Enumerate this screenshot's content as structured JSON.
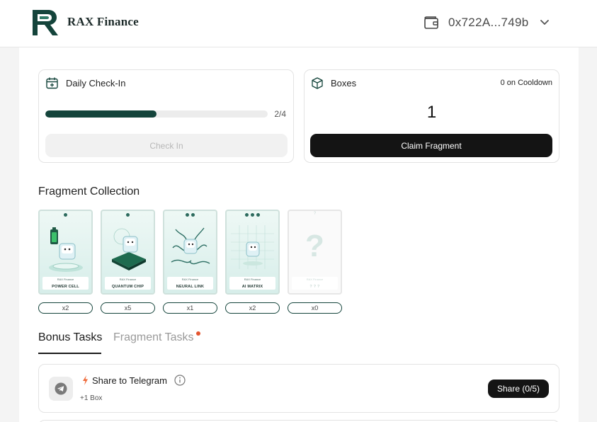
{
  "header": {
    "brand": "RAX Finance",
    "wallet_address": "0x722A...749b",
    "logo_icon": "rax-logo-icon",
    "wallet_icon": "wallet-icon",
    "chevron_icon": "chevron-down-icon"
  },
  "checkin": {
    "title": "Daily Check-In",
    "progress_label": "2/4",
    "progress": 0.5,
    "button_label": "Check In",
    "button_disabled": true
  },
  "boxes": {
    "title": "Boxes",
    "cooldown": "0 on Cooldown",
    "count": "1",
    "button_label": "Claim Fragment"
  },
  "collection": {
    "title": "Fragment Collection",
    "fragments": [
      {
        "name": "POWER CELL",
        "brand": "RAX Finance",
        "count": "x2",
        "tier": 1
      },
      {
        "name": "QUANTUM CHIP",
        "brand": "RAX Finance",
        "count": "x5",
        "tier": 1
      },
      {
        "name": "NEURAL LINK",
        "brand": "RAX Finance",
        "count": "x1",
        "tier": 2
      },
      {
        "name": "AI MATRIX",
        "brand": "RAX Finance",
        "count": "x2",
        "tier": 3
      },
      {
        "name": "? ? ?",
        "brand": "RAX Finance",
        "count": "x0",
        "tier": 0,
        "mark": "?",
        "small_mark": "?"
      }
    ]
  },
  "tabs": {
    "bonus": "Bonus Tasks",
    "fragment": "Fragment Tasks",
    "active": "bonus"
  },
  "tasks": [
    {
      "title": "Share to Telegram",
      "reward": "+1 Box",
      "button_label": "Share (0/5)",
      "icon": "telegram-icon"
    }
  ],
  "colors": {
    "accent": "#14443b",
    "button_dark": "#141414",
    "notification_dot": "#e4542f"
  }
}
